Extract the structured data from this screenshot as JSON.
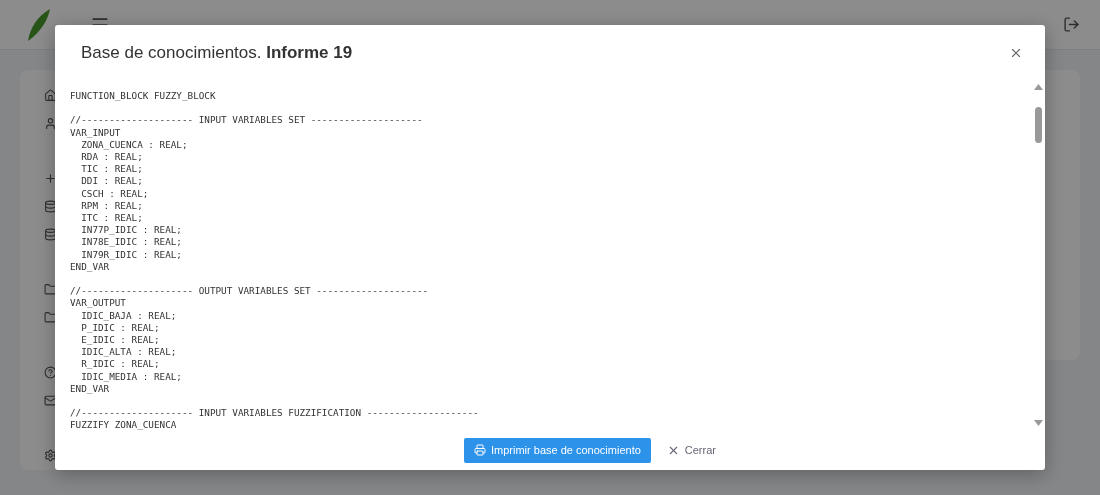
{
  "modal": {
    "title": "Base de conocimientos. **Informe 19**",
    "code_blocks": [
      [
        "FUNCTION_BLOCK FUZZY_BLOCK"
      ],
      [
        "//-------------------- INPUT VARIABLES SET --------------------",
        "VAR_INPUT",
        "  ZONA_CUENCA : REAL;",
        "  RDA : REAL;",
        "  TIC : REAL;",
        "  DDI : REAL;",
        "  CSCH : REAL;",
        "  RPM : REAL;",
        "  ITC : REAL;",
        "  IN77P_IDIC : REAL;",
        "  IN78E_IDIC : REAL;",
        "  IN79R_IDIC : REAL;",
        "END_VAR"
      ],
      [
        "//-------------------- OUTPUT VARIABLES SET --------------------",
        "VAR_OUTPUT",
        "  IDIC_BAJA : REAL;",
        "  P_IDIC : REAL;",
        "  E_IDIC : REAL;",
        "  IDIC_ALTA : REAL;",
        "  R_IDIC : REAL;",
        "  IDIC_MEDIA : REAL;",
        "END_VAR"
      ],
      [
        "//-------------------- INPUT VARIABLES FUZZIFICATION --------------------",
        "FUZZIFY ZONA_CUENCA"
      ]
    ],
    "buttons": [
      {
        "kind": "primary",
        "label": "Imprimir base de conocimiento"
      },
      {
        "kind": "link",
        "label": "Cerrar"
      }
    ]
  }
}
